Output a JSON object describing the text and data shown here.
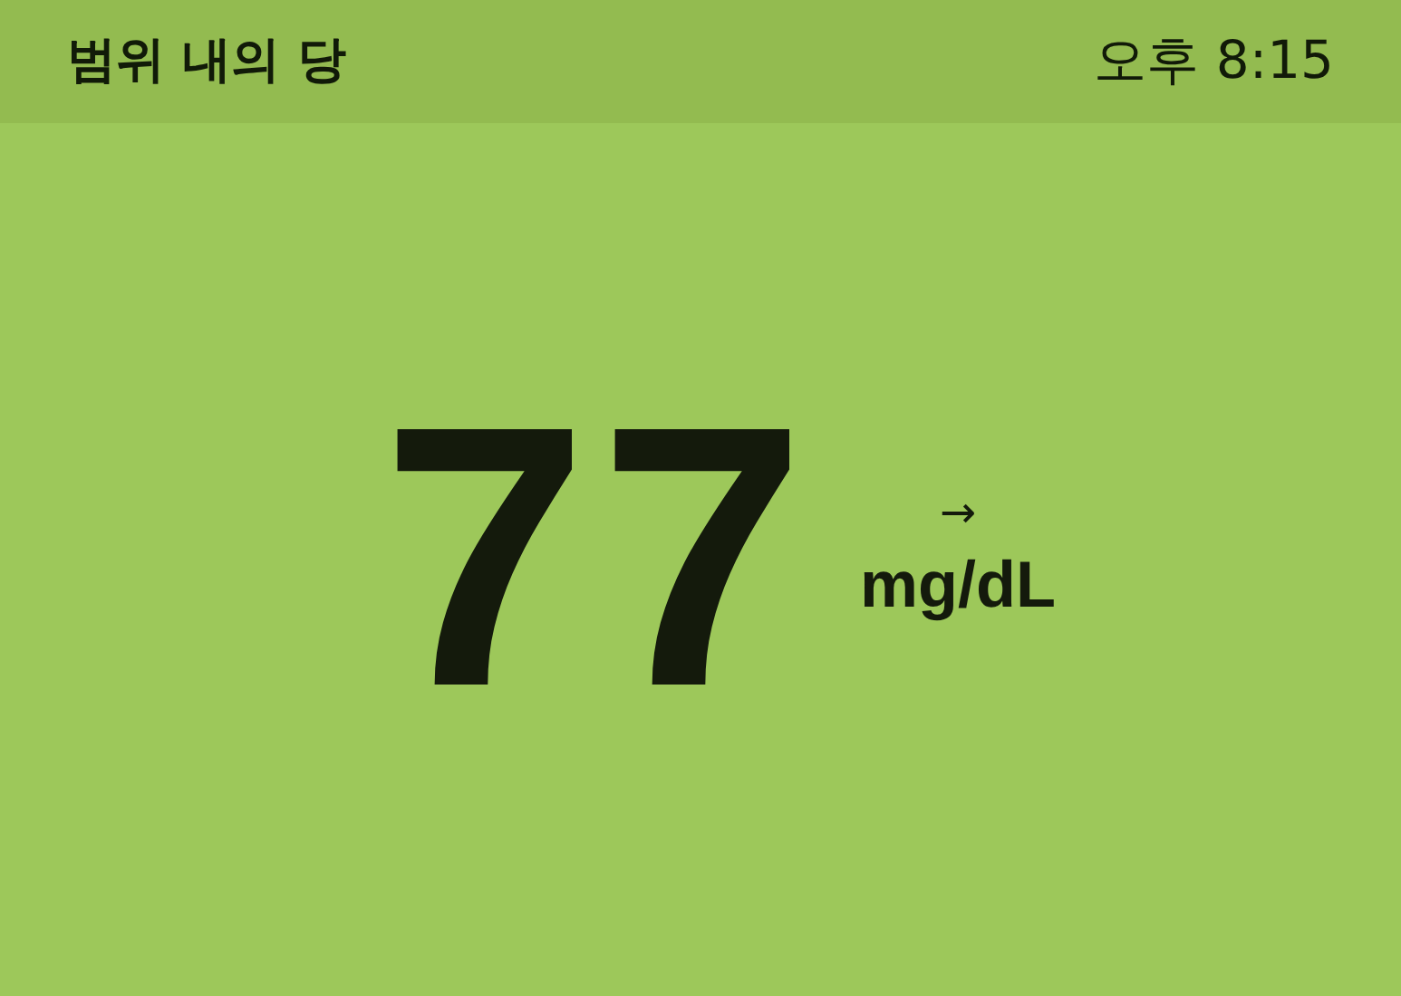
{
  "header": {
    "title": "범위 내의 당",
    "time": "오후 8:15"
  },
  "reading": {
    "value": "77",
    "trend_arrow": "→",
    "unit": "mg/dL"
  }
}
